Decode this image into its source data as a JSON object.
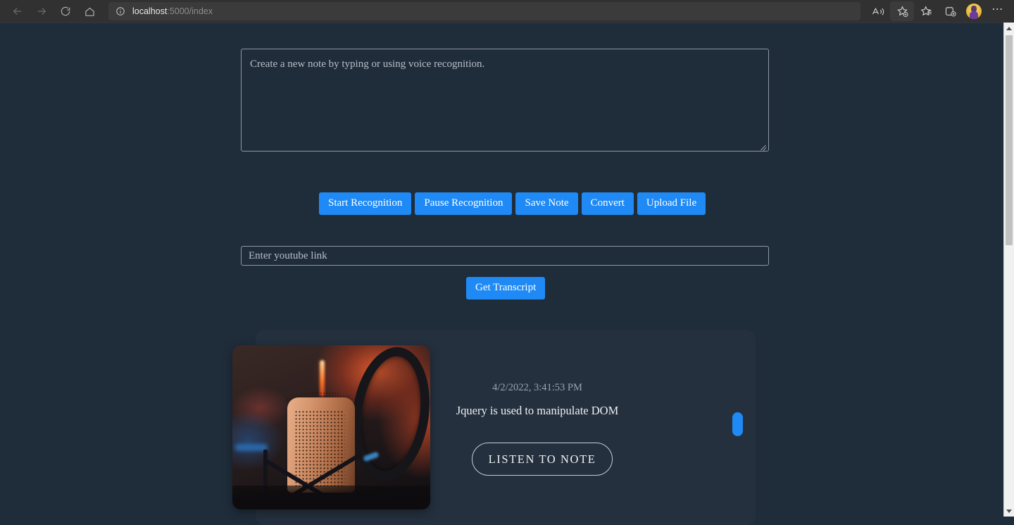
{
  "browser": {
    "back_label": "Back",
    "forward_label": "Forward",
    "refresh_label": "Refresh",
    "home_label": "Home",
    "site_info_label": "View site information",
    "url_host": "localhost",
    "url_path": ":5000/index",
    "read_aloud_label": "Read aloud",
    "add_favorite_label": "Add this page to favorites",
    "favorites_label": "Favorites",
    "collections_label": "Collections",
    "profile_label": "Profile",
    "settings_label": "Settings and more"
  },
  "page": {
    "note_input": {
      "placeholder": "Create a new note by typing or using voice recognition.",
      "value": ""
    },
    "actions": [
      {
        "label": "Start Recognition",
        "name": "start-recognition-button"
      },
      {
        "label": "Pause Recognition",
        "name": "pause-recognition-button"
      },
      {
        "label": "Save Note",
        "name": "save-note-button"
      },
      {
        "label": "Convert",
        "name": "convert-button"
      },
      {
        "label": "Upload File",
        "name": "upload-file-button"
      }
    ],
    "youtube_input": {
      "placeholder": "Enter youtube link",
      "value": ""
    },
    "get_transcript_label": "Get Transcript",
    "note_card": {
      "image_alt": "studio-microphone-photo",
      "date": "4/2/2022, 3:41:53 PM",
      "text": "Jquery is used to manipulate DOM",
      "listen_label": "LISTEN TO NOTE",
      "toggle_label": ""
    }
  },
  "colors": {
    "page_background": "#1f2c3a",
    "accent_blue": "#1f8af5",
    "chrome_background": "#323131",
    "text_light": "#edf0f3",
    "text_muted": "#9aa4ae",
    "border": "#8e98a3"
  }
}
